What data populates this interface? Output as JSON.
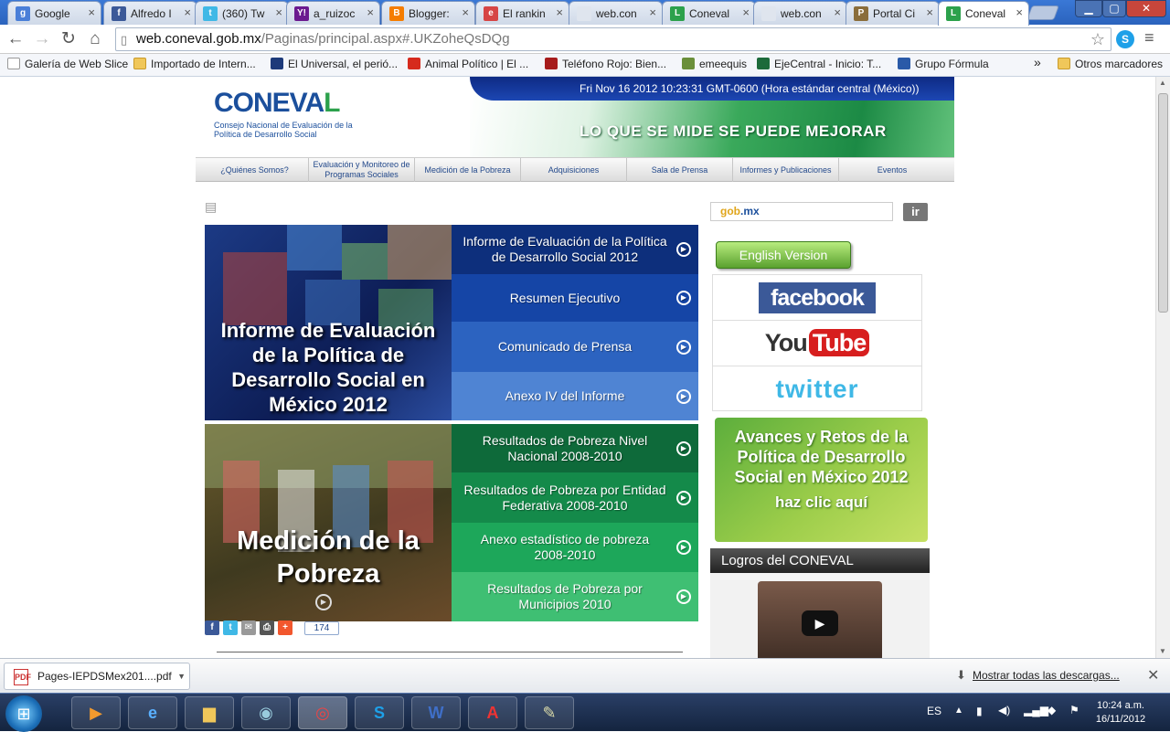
{
  "browser": {
    "tabs": [
      {
        "label": "Google",
        "icon": "google-icon",
        "color": "#4a7fd8",
        "glyph": "g"
      },
      {
        "label": "Alfredo I",
        "icon": "facebook-icon",
        "color": "#3b5998",
        "glyph": "f"
      },
      {
        "label": "(360) Tw",
        "icon": "twitter-icon",
        "color": "#3fb8e6",
        "glyph": "t"
      },
      {
        "label": "a_ruizoc",
        "icon": "yahoo-icon",
        "color": "#6b1a8f",
        "glyph": "Y!"
      },
      {
        "label": "Blogger:",
        "icon": "blogger-icon",
        "color": "#f57d00",
        "glyph": "B"
      },
      {
        "label": "El rankin",
        "icon": "news-icon",
        "color": "#d64545",
        "glyph": "e"
      },
      {
        "label": "web.con",
        "icon": "page-icon",
        "color": "#dfe5ee",
        "glyph": ""
      },
      {
        "label": "Coneval",
        "icon": "coneval-icon",
        "color": "#2ca14c",
        "glyph": "L"
      },
      {
        "label": "web.con",
        "icon": "page-icon",
        "color": "#dfe5ee",
        "glyph": ""
      },
      {
        "label": "Portal Ci",
        "icon": "portal-icon",
        "color": "#8a6d3b",
        "glyph": "P"
      },
      {
        "label": "Coneval",
        "icon": "coneval-icon",
        "color": "#2ca14c",
        "glyph": "L"
      }
    ],
    "active_tab": 10,
    "url_domain": "web.coneval.gob.mx",
    "url_path": "/Paginas/principal.aspx#.UKZoheQsDQg",
    "bookmarks": [
      {
        "label": "Galería de Web Slice",
        "icon": "page-icon"
      },
      {
        "label": "Importado de Intern...",
        "icon": "folder-icon"
      },
      {
        "label": "El Universal, el perió...",
        "icon": "eluniversal-icon"
      },
      {
        "label": "Animal Político | El ...",
        "icon": "animalpolitico-icon"
      },
      {
        "label": "Teléfono Rojo: Bien...",
        "icon": "telefonorojo-icon"
      },
      {
        "label": "emeequis",
        "icon": "emeequis-icon"
      },
      {
        "label": "EjeCentral - Inicio: T...",
        "icon": "ejecentral-icon"
      },
      {
        "label": "Grupo Fórmula",
        "icon": "grupoformula-icon"
      }
    ],
    "bookmarks_overflow": "»",
    "other_bookmarks": "Otros marcadores"
  },
  "site": {
    "logo_text": "CONEVAL",
    "logo_subtitle": "Consejo Nacional de Evaluación de la Política de Desarrollo Social",
    "date_text": "Fri Nov  16 2012 10:23:31 GMT-0600 (Hora estándar central (México))",
    "slogan": "LO QUE SE MIDE SE PUEDE MEJORAR",
    "menu": [
      "¿Quiénes Somos?",
      "Evaluación y Monitoreo de Programas Sociales",
      "Medición de la Pobreza",
      "Adquisiciones",
      "Sala de Prensa",
      "Informes y Publicaciones",
      "Eventos"
    ],
    "feature1_title": "Informe de Evaluación de la Política de Desarrollo Social en México 2012",
    "feature1_links": [
      "Informe de Evaluación de la Política de Desarrollo Social 2012",
      "Resumen Ejecutivo",
      "Comunicado de Prensa",
      "Anexo IV del Informe"
    ],
    "feature2_title": "Medición de la Pobreza",
    "feature2_links": [
      "Resultados de Pobreza Nivel Nacional 2008-2010",
      "Resultados de Pobreza  por Entidad  Federativa 2008-2010",
      "Anexo estadístico de pobreza 2008-2010",
      "Resultados de Pobreza por Municipios 2010"
    ],
    "share_count": "174",
    "gob_search": "gob.mx",
    "ir_button": "ir",
    "english_button": "English Version",
    "facebook_label": "facebook",
    "youtube_label_a": "You",
    "youtube_label_b": "Tube",
    "twitter_label": "twitter",
    "avances_title": "Avances y Retos de la Política de Desarrollo Social en México 2012",
    "avances_cta": "haz clic aquí",
    "logros_title": "Logros del CONEVAL"
  },
  "downloads": {
    "file": "Pages-IEPDSMex201....pdf",
    "show_all": "Mostrar todas las descargas..."
  },
  "taskbar": {
    "lang": "ES",
    "time": "10:24 a.m.",
    "date": "16/11/2012"
  }
}
